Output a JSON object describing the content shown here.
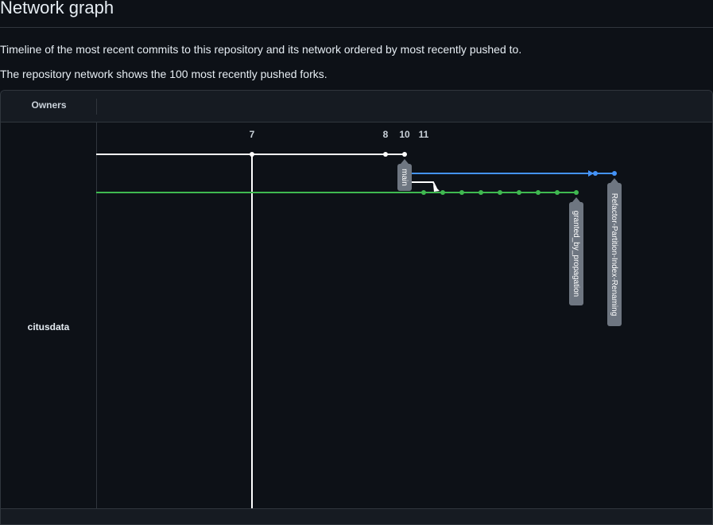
{
  "page": {
    "title": "Network graph",
    "description_1": "Timeline of the most recent commits to this repository and its network ordered by most recently pushed to.",
    "description_2": "The repository network shows the 100 most recently pushed forks."
  },
  "graph": {
    "owners_header": "Owners",
    "owner": "citusdata",
    "date_labels": [
      "7",
      "8",
      "10",
      "11"
    ],
    "branches": [
      {
        "name": "main",
        "color": "#ffffff"
      },
      {
        "name": "granted_by_propagation",
        "color": "#3fb950"
      },
      {
        "name": "Refactor-Partition-Index-Renaming",
        "color": "#4493f8"
      }
    ],
    "colors": {
      "background": "#0d1117",
      "panel": "#161b22",
      "border": "#30363d",
      "label_bg": "#6e7681"
    }
  }
}
